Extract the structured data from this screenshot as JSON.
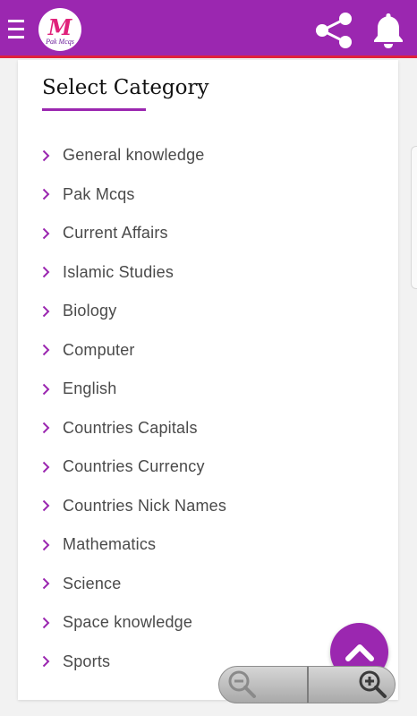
{
  "app": {
    "logo_text": "Pak Mcqs",
    "logo_mark": "M",
    "brand_color": "#9b27b0",
    "accent_line_color": "#e0213d"
  },
  "header": {
    "menu_icon": "hamburger-menu-icon",
    "share_icon": "share-icon",
    "notification_icon": "bell-icon"
  },
  "category_panel": {
    "title": "Select Category",
    "items": [
      {
        "label": "General knowledge"
      },
      {
        "label": "Pak Mcqs"
      },
      {
        "label": "Current Affairs"
      },
      {
        "label": "Islamic Studies"
      },
      {
        "label": "Biology"
      },
      {
        "label": "Computer"
      },
      {
        "label": "English"
      },
      {
        "label": "Countries Capitals"
      },
      {
        "label": "Countries Currency"
      },
      {
        "label": "Countries Nick Names"
      },
      {
        "label": "Mathematics"
      },
      {
        "label": "Science"
      },
      {
        "label": "Space knowledge"
      },
      {
        "label": "Sports"
      }
    ]
  },
  "floating": {
    "scroll_top_icon": "chevron-up-icon",
    "zoom_out_icon": "zoom-out-icon",
    "zoom_in_icon": "zoom-in-icon"
  }
}
